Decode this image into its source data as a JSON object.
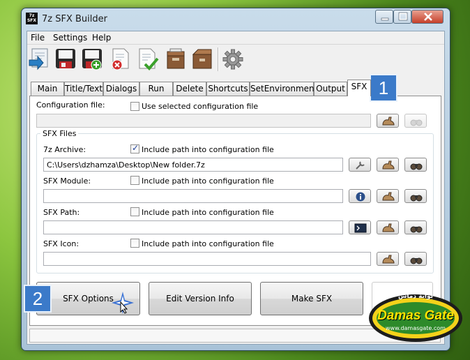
{
  "window": {
    "title": "7z SFX Builder",
    "icon_text": "7z SFX"
  },
  "menu": {
    "file": "File",
    "settings": "Settings",
    "help": "Help"
  },
  "toolbar_icons": [
    "save-as-icon",
    "save-icon",
    "save-new-icon",
    "delete-config-icon",
    "check-config-icon",
    "archive-box-icon",
    "archive-open-icon",
    "settings-gear-icon"
  ],
  "tabs": [
    "Main",
    "Title/Text",
    "Dialogs",
    "Run",
    "Delete",
    "Shortcuts",
    "SetEnvironment",
    "Output",
    "SFX"
  ],
  "active_tab": "SFX",
  "config": {
    "label": "Configuration file:",
    "use_selected": "Use selected configuration file",
    "value": ""
  },
  "sfx_files": {
    "legend": "SFX Files",
    "archive": {
      "label": "7z Archive:",
      "include": "Include path into configuration file",
      "checked": true,
      "value": "C:\\Users\\dzhamza\\Desktop\\New folder.7z"
    },
    "module": {
      "label": "SFX Module:",
      "include": "Include path into configuration file",
      "checked": false,
      "value": ""
    },
    "path": {
      "label": "SFX Path:",
      "include": "Include path into configuration file",
      "checked": false,
      "value": ""
    },
    "icon": {
      "label": "SFX Icon:",
      "include": "Include path into configuration file",
      "checked": false,
      "value": ""
    }
  },
  "buttons": {
    "sfx_options": "SFX Options",
    "edit_version": "Edit Version Info",
    "make_sfx": "Make SFX"
  },
  "annotations": {
    "badge1": "1",
    "badge2": "2"
  },
  "watermark": {
    "brand": "Damas Gate",
    "url": "www.damasgate.com",
    "arabic": "بوابة دماس"
  },
  "colors": {
    "accent": "#3b7ac9",
    "check": "#1e3f99",
    "close": "#c6402a"
  }
}
